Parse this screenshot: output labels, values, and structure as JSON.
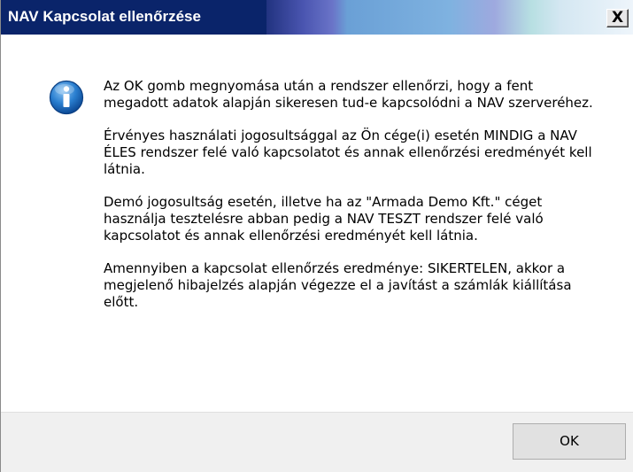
{
  "window": {
    "title": "NAV Kapcsolat ellenőrzése",
    "close_glyph": "X"
  },
  "icon": "info-icon",
  "message": {
    "paragraphs": [
      "Az OK gomb megnyomása után a rendszer ellenőrzi, hogy a fent megadott adatok alapján sikeresen tud-e kapcsolódni a NAV szerveréhez.",
      "Érvényes használati jogosultsággal az Ön cége(i) esetén MINDIG a NAV ÉLES rendszer felé való kapcsolatot és annak ellenőrzési eredményét kell látnia.",
      "Demó jogosultság esetén, illetve ha az \"Armada Demo Kft.\" céget használja tesztelésre abban pedig a NAV TESZT rendszer felé való kapcsolatot és annak ellenőrzési eredményét kell látnia.",
      "Amennyiben a kapcsolat ellenőrzés eredménye: SIKERTELEN, akkor a megjelenő hibajelzés alapján végezze el a javítást a számlák kiállítása előtt."
    ]
  },
  "buttons": {
    "ok_label": "OK"
  },
  "colors": {
    "title_bg": "#0a246a",
    "title_text": "#ffffff",
    "footer_bg": "#f0f0f0",
    "icon_blue": "#1c6fc4"
  }
}
